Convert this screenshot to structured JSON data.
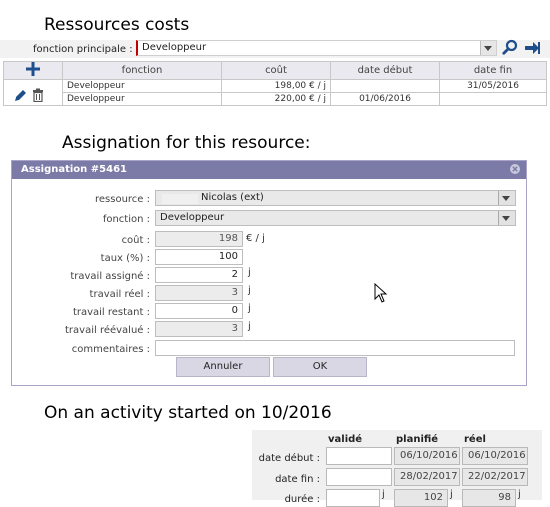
{
  "headings": {
    "costs": "Ressources costs",
    "assignation": "Assignation for this resource:",
    "activity": "On an activity started on 10/2016"
  },
  "costs_filter": {
    "label": "fonction principale :",
    "value": "Developpeur"
  },
  "cost_table": {
    "headers": [
      "fonction",
      "coût",
      "date début",
      "date fin"
    ],
    "rows": [
      {
        "fonction": "Developpeur",
        "cout": "198,00 € / j",
        "date_debut": "",
        "date_fin": "31/05/2016"
      },
      {
        "fonction": "Developpeur",
        "cout": "220,00 € / j",
        "date_debut": "01/06/2016",
        "date_fin": ""
      }
    ]
  },
  "dialog": {
    "title": "Assignation #5461",
    "labels": {
      "ressource": "ressource :",
      "fonction": "fonction :",
      "cout": "coût :",
      "taux": "taux (%) :",
      "travail_assigne": "travail assigné :",
      "travail_reel": "travail réel :",
      "travail_restant": "travail restant :",
      "travail_reevalue": "travail réévalué :",
      "commentaires": "commentaires :"
    },
    "values": {
      "ressource": "Nicolas (ext)",
      "fonction": "Developpeur",
      "cout": "198",
      "taux": "100",
      "travail_assigne": "2",
      "travail_reel": "3",
      "travail_restant": "0",
      "travail_reevalue": "3",
      "commentaires": ""
    },
    "units": {
      "cout": "€ / j",
      "travail": "j"
    },
    "buttons": {
      "cancel": "Annuler",
      "ok": "OK"
    }
  },
  "activity": {
    "columns": {
      "valide": "validé",
      "planifie": "planifié",
      "reel": "réel"
    },
    "labels": {
      "date_debut": "date début :",
      "date_fin": "date fin :",
      "duree": "durée :"
    },
    "planifie": {
      "date_debut": "06/10/2016",
      "date_fin": "28/02/2017",
      "duree": "102"
    },
    "reel": {
      "date_debut": "06/10/2016",
      "date_fin": "22/02/2017",
      "duree": "98"
    },
    "duree_unit": "j"
  },
  "colors": {
    "dialog_title_bar": "#7c7ba7",
    "required_marker": "#c00000",
    "icon_blue": "#1f4e8c"
  }
}
